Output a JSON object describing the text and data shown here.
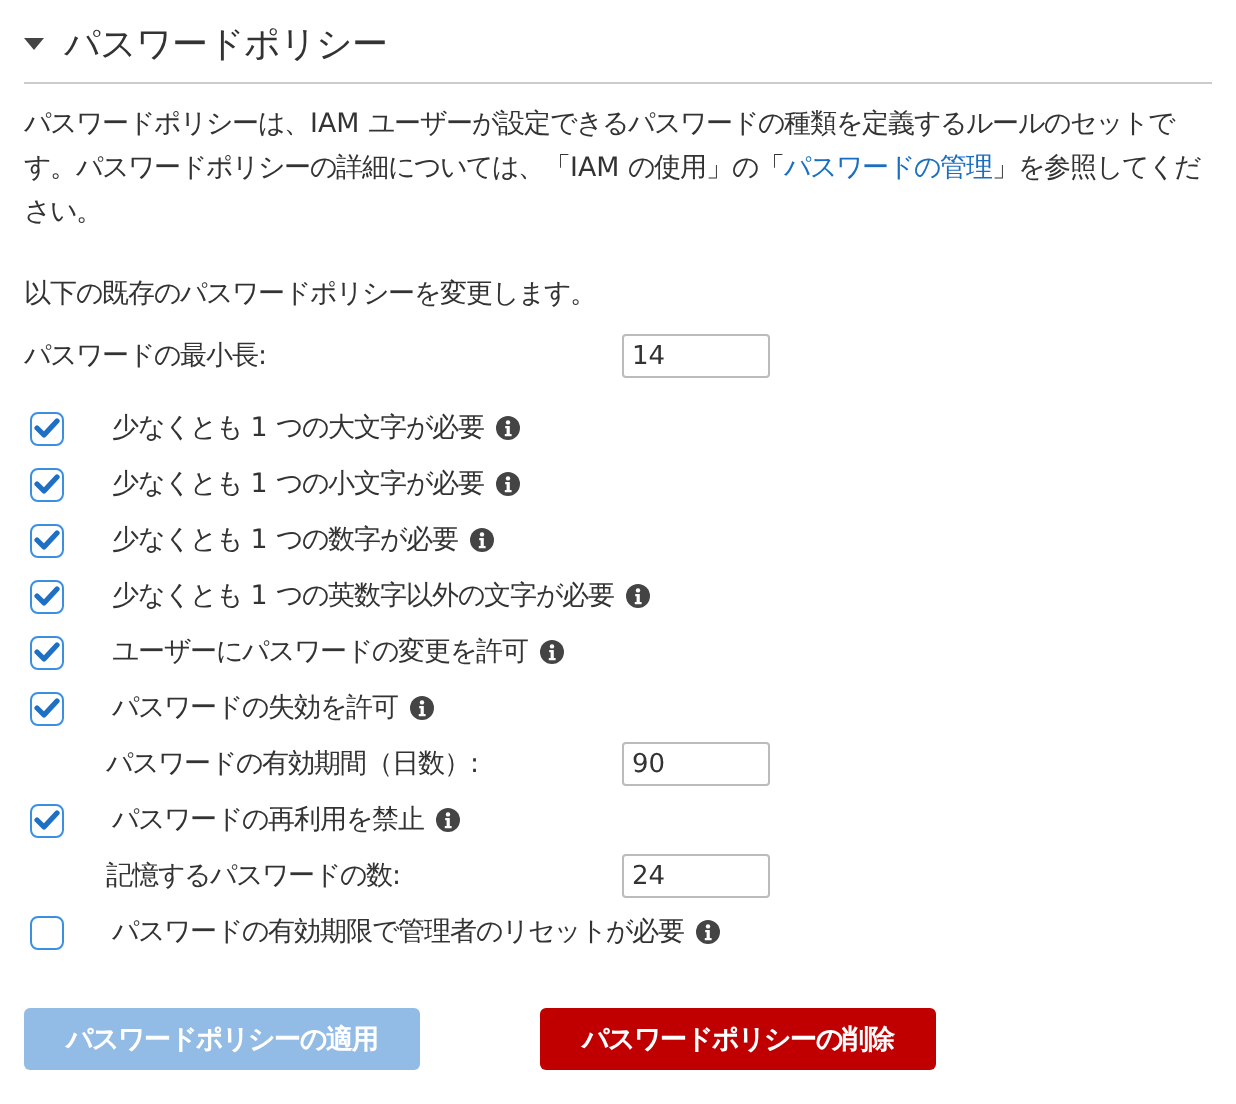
{
  "section": {
    "title": "パスワードポリシー",
    "expanded": true
  },
  "description": {
    "before": "パスワードポリシーは、IAM ユーザーが設定できるパスワードの種類を定義するルールのセットです。パスワードポリシーの詳細については、「IAM の使用」の「",
    "link": "パスワードの管理",
    "after": "」を参照してください。"
  },
  "notice": "以下の既存のパスワードポリシーを変更します。",
  "min_length": {
    "label": "パスワードの最小長:",
    "value": "14"
  },
  "options": [
    {
      "kind": "checkbox",
      "label": "少なくとも 1 つの大文字が必要",
      "checked": true
    },
    {
      "kind": "checkbox",
      "label": "少なくとも 1 つの小文字が必要",
      "checked": true
    },
    {
      "kind": "checkbox",
      "label": "少なくとも 1 つの数字が必要",
      "checked": true
    },
    {
      "kind": "checkbox",
      "label": "少なくとも 1 つの英数字以外の文字が必要",
      "checked": true
    },
    {
      "kind": "checkbox",
      "label": "ユーザーにパスワードの変更を許可",
      "checked": true
    },
    {
      "kind": "checkbox",
      "label": "パスワードの失効を許可",
      "checked": true
    },
    {
      "kind": "field",
      "label": "パスワードの有効期間（日数）:",
      "value": "90"
    },
    {
      "kind": "checkbox",
      "label": "パスワードの再利用を禁止",
      "checked": true
    },
    {
      "kind": "field",
      "label": "記憶するパスワードの数:",
      "value": "24"
    },
    {
      "kind": "checkbox",
      "label": "パスワードの有効期限で管理者のリセットが必要",
      "checked": false
    }
  ],
  "buttons": [
    {
      "kind": "primary",
      "label": "パスワードポリシーの適用",
      "disabled": true
    },
    {
      "kind": "danger",
      "label": "パスワードポリシーの削除",
      "disabled": false
    }
  ]
}
